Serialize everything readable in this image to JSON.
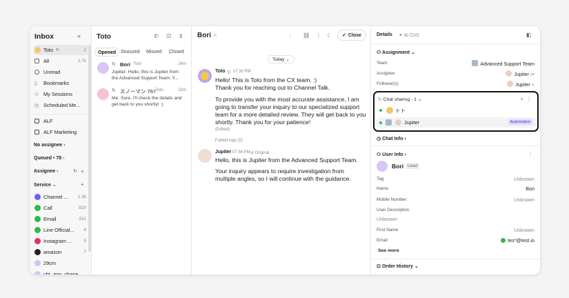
{
  "inbox": {
    "title": "Inbox",
    "items": [
      {
        "label": "Toto",
        "count": "2"
      },
      {
        "label": "All",
        "count": "2.7k"
      },
      {
        "label": "Unread",
        "count": ""
      },
      {
        "label": "Bookmarks",
        "count": ""
      },
      {
        "label": "My Sessions",
        "count": ""
      },
      {
        "label": "Scheduled Me...",
        "count": ""
      }
    ],
    "teams": [
      {
        "label": "ALF"
      },
      {
        "label": "ALF Marketing"
      }
    ],
    "no_assignee": "No assignee",
    "queued": "Queued • 78",
    "assignee": "Assignee",
    "service": "Service",
    "channels": [
      {
        "label": "Channel ...",
        "count": "1.3k",
        "color": "#6b5cff"
      },
      {
        "label": "Call",
        "count": "820",
        "color": "#2db84d"
      },
      {
        "label": "Email",
        "count": "331",
        "color": "#2db84d"
      },
      {
        "label": "Line Official...",
        "count": "4",
        "color": "#2db84d"
      },
      {
        "label": "Instagram ...",
        "count": "5",
        "color": "#e1306c"
      },
      {
        "label": "amazon",
        "count": "7",
        "color": "#222222"
      },
      {
        "label": "29cm",
        "count": "",
        "color": "#c9c9f5"
      },
      {
        "label": "cht_app_chase...",
        "count": "",
        "color": "#c9c9f5"
      }
    ]
  },
  "list": {
    "title": "Toto",
    "tabs": [
      "Opened",
      "Snoozed",
      "Missed",
      "Closed"
    ],
    "items": [
      {
        "name": "Bori",
        "assignee": "· Toto",
        "time": "24m",
        "preview": "Jupiter: Hello, this is Jupiter from the Advanced Support Team. Y..."
      },
      {
        "name": "スノーマン 767",
        "assignee": "· Toto",
        "time": "32m",
        "preview": "Me: Sure, I'll check the details and get back to you shortly! :)"
      }
    ]
  },
  "chat": {
    "title": "Bori",
    "close_label": "Close",
    "date_divider": "Today",
    "messages": [
      {
        "sender": "Toto",
        "time": "07:30 PM",
        "text": "Hello! This is Toto from the CX team. :)\nThank you for reaching out to Channel Talk.",
        "text2": "To provide you with the most accurate assistance, I am going to transfer your inquiry to our specialized support team for a more detailed review. They will get back to you shortly. Thank you for your patience!",
        "edited": "(Edited)"
      },
      {
        "sender": "Jupiter",
        "time": "07:34 PM",
        "tag": "Original",
        "text": "Hello, this is Jupiter from the Advanced Support Team.",
        "text2": "Your inquiry appears to require investigation from multiple angles, so I will continue with the guidance."
      }
    ],
    "folded_logs": "Folded logs (5)"
  },
  "details": {
    "tab_details": "Details",
    "tab_aicos": "AI CoS",
    "assignment": "Assignment",
    "team_label": "Team",
    "team_value": "Advanced Support Team",
    "assignee_label": "Assignee",
    "assignee_value": "Jupiter",
    "followers_label": "Follower(s)",
    "followers_value": "Jupiter",
    "chat_sharing": "Chat sharing · 1",
    "sharing_rows": [
      {
        "name": "トト",
        "badge": ""
      },
      {
        "name": "Jupiter",
        "badge": "Automation"
      }
    ],
    "chat_info": "Chat Info",
    "user_info": "User Info",
    "user_name": "Bori",
    "user_badge": "Lead",
    "fields": [
      {
        "label": "Tag",
        "value": "Unknown"
      },
      {
        "label": "Name",
        "value": "Bori"
      },
      {
        "label": "Mobile Number",
        "value": "Unknown"
      },
      {
        "label": "User Description",
        "value": "Unknown"
      },
      {
        "label": "First Name",
        "value": "Unknown"
      },
      {
        "label": "Email",
        "value": "tes*@test.io"
      }
    ],
    "see_more": "See more",
    "order_history": "Order History"
  }
}
